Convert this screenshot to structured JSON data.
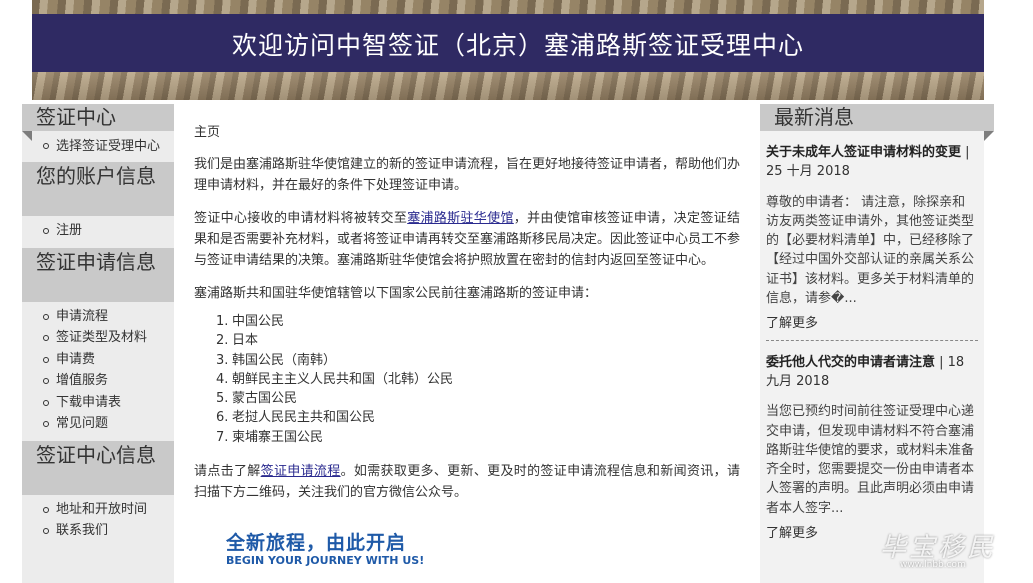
{
  "banner": {
    "title": "欢迎访问中智签证（北京）塞浦路斯签证受理中心"
  },
  "left_sidebar": {
    "sections": [
      {
        "heading": "签证中心",
        "items": [
          "选择签证受理中心"
        ]
      },
      {
        "heading": "您的账户信息",
        "items": [
          "注册"
        ]
      },
      {
        "heading": "签证申请信息",
        "items": [
          "申请流程",
          "签证类型及材料",
          "申请费",
          "增值服务",
          "下载申请表",
          "常见问题"
        ]
      },
      {
        "heading": "签证中心信息",
        "items": [
          "地址和开放时间",
          "联系我们"
        ]
      }
    ]
  },
  "main": {
    "breadcrumb": "主页",
    "para1": "我们是由塞浦路斯驻华使馆建立的新的签证申请流程，旨在更好地接待签证申请者，帮助他们办理申请材料，并在最好的条件下处理签证申请。",
    "para2_before": "签证中心接收的申请材料将被转交至",
    "para2_link": "塞浦路斯驻华使馆",
    "para2_after": "，并由使馆审核签证申请，决定签证结果和是否需要补充材料，或者将签证申请再转交至塞浦路斯移民局决定。因此签证中心员工不参与签证申请结果的决策。塞浦路斯驻华使馆会将护照放置在密封的信封内返回至签证中心。",
    "para3": "塞浦路斯共和国驻华使馆辖管以下国家公民前往塞浦路斯的签证申请：",
    "nations": [
      "中国公民",
      "日本",
      "韩国公民（南韩）",
      "朝鲜民主主义人民共和国（北韩）公民",
      "蒙古国公民",
      "老挝人民民主共和国公民",
      "柬埔寨王国公民"
    ],
    "para4_before": "请点击了解",
    "para4_link": "签证申请流程",
    "para4_after": "。如需获取更多、更新、更及时的签证申请流程信息和新闻资讯，请扫描下方二维码，关注我们的官方微信公众号。",
    "promo_cn": "全新旅程，由此开启",
    "promo_en": "BEGIN YOUR JOURNEY WITH US!"
  },
  "news": {
    "heading": "最新消息",
    "items": [
      {
        "title": "关于未成年人签证申请材料的变更",
        "date": " | 25 十月 2018",
        "body": "尊敬的申请者： 请注意，除探亲和访友两类签证申请外，其他签证类型的【必要材料清单】中，已经移除了【经过中国外交部认证的亲属关系公证书】该材料。更多关于材料清单的信息，请参�...",
        "more": "了解更多"
      },
      {
        "title": "委托他人代交的申请者请注意",
        "date": " | 18 九月 2018",
        "body": "当您已预约时间前往签证受理中心递交申请，但发现申请材料不符合塞浦路斯驻华使馆的要求，或材料未准备齐全时，您需要提交一份由申请者本人签署的声明。且此声明必须由申请者本人签字...",
        "more": "了解更多"
      }
    ]
  },
  "watermark": {
    "text": "毕宝移民",
    "url": "www.lnbb.com"
  }
}
